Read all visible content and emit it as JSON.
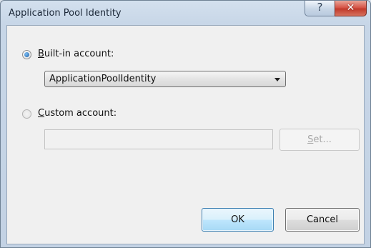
{
  "window": {
    "title": "Application Pool Identity",
    "help_glyph": "?",
    "close_glyph": "✕"
  },
  "builtin": {
    "selected": true,
    "label_accesskey": "B",
    "label_rest": "uilt-in account:",
    "dropdown_value": "ApplicationPoolIdentity"
  },
  "custom": {
    "selected": false,
    "label_accesskey": "C",
    "label_rest": "ustom account:",
    "textbox_value": "",
    "set_button_accesskey": "S",
    "set_button_rest": "et..."
  },
  "buttons": {
    "ok": "OK",
    "cancel": "Cancel"
  },
  "colors": {
    "accent": "#3c7fb1",
    "close_red": "#c13a2b"
  }
}
